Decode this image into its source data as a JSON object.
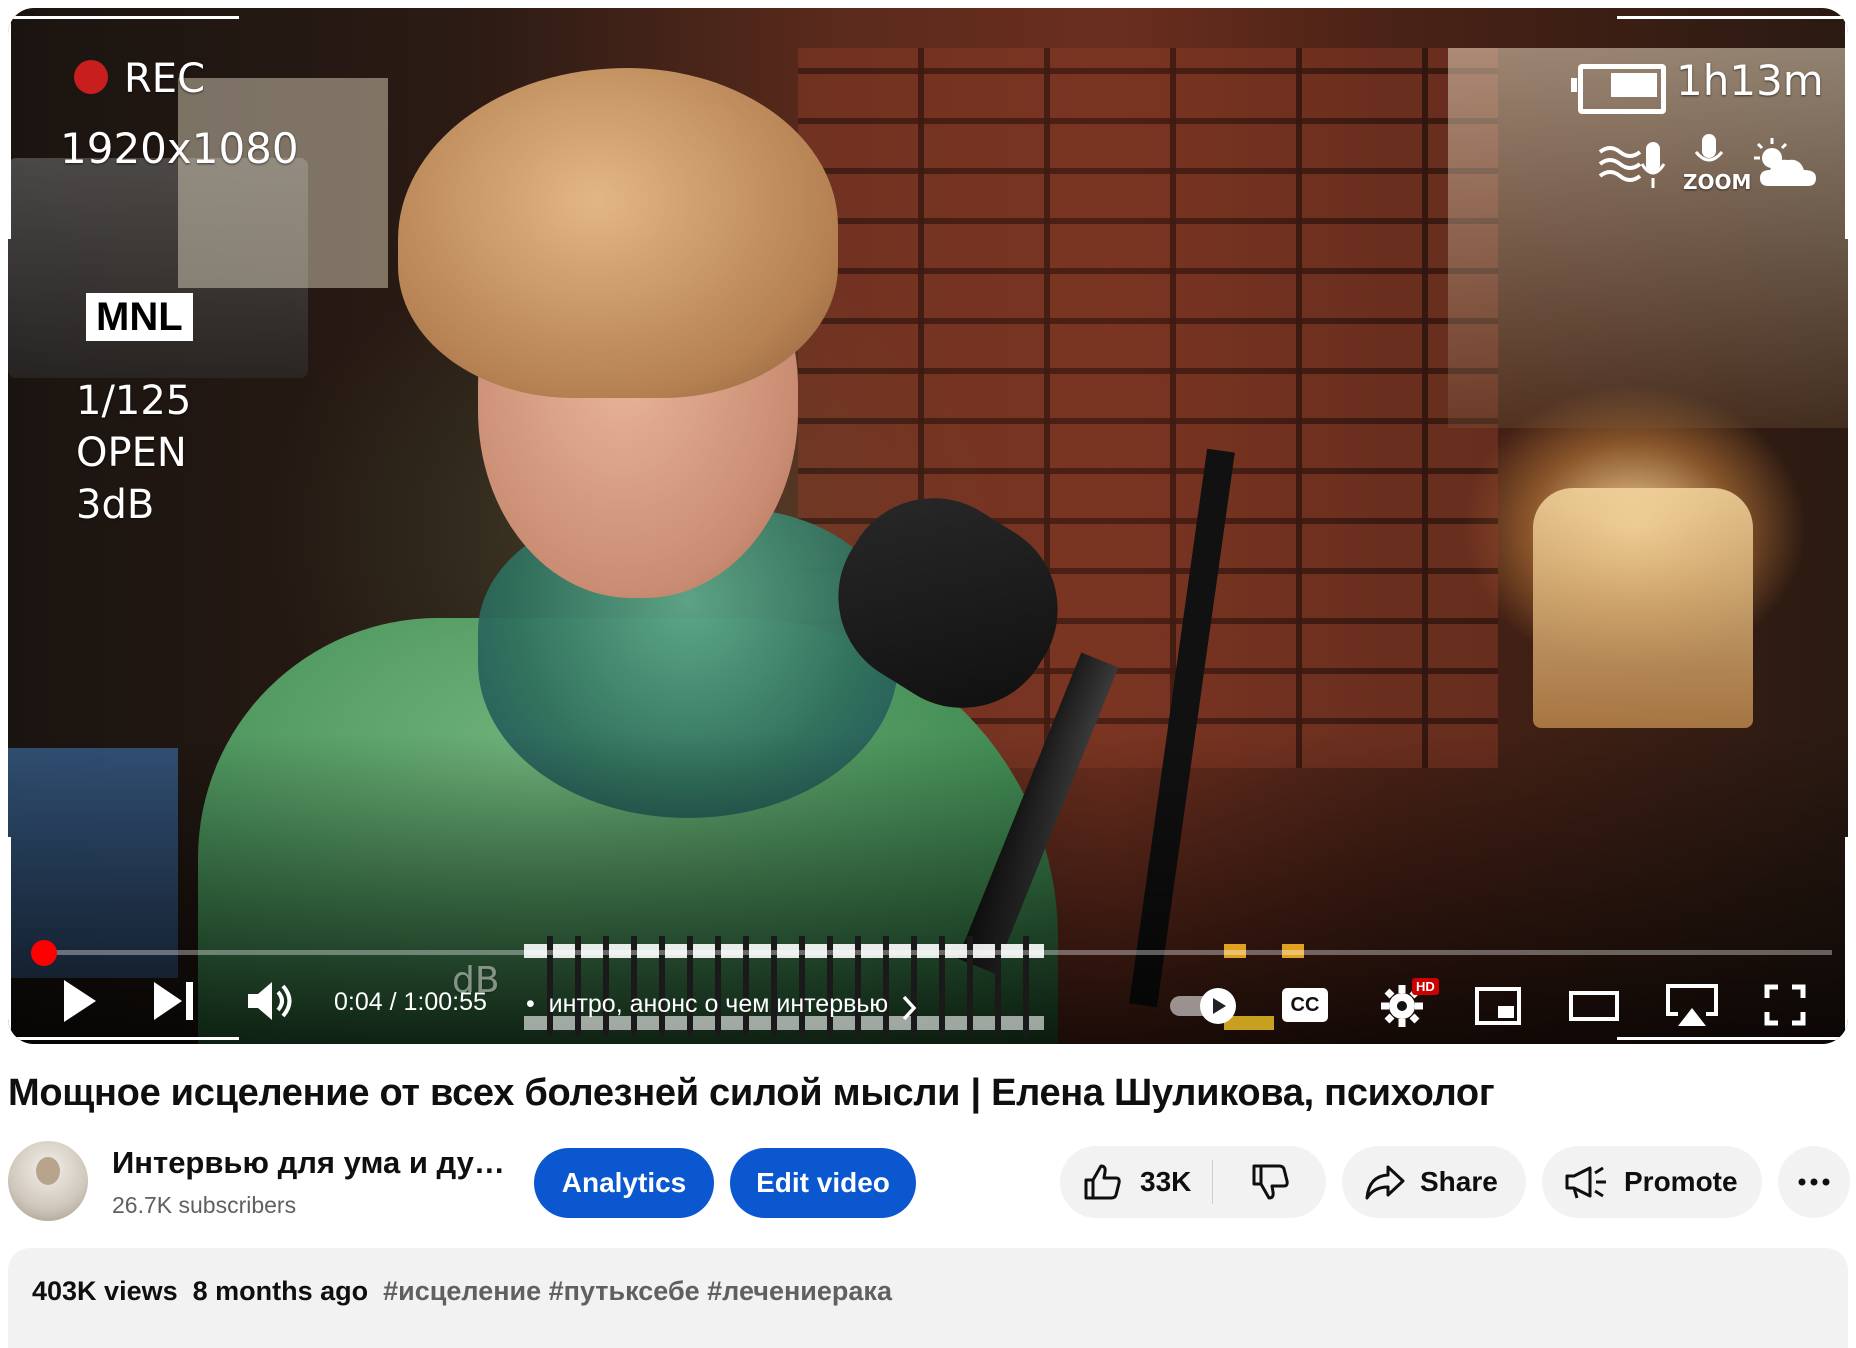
{
  "osd": {
    "rec": "REC",
    "resolution": "1920x1080",
    "mode": "MNL",
    "shutter": "1/125",
    "aperture": "OPEN",
    "gain": "3dB",
    "remaining": "1h13m",
    "zoom": "ZOOM",
    "meter_unit": "dB"
  },
  "player": {
    "time": "0:04 / 1:00:55",
    "chapter_separator": "•",
    "chapter": "интро, анонс о чем интервью",
    "quality_badge": "HD",
    "cc_label": "CC",
    "progress": 0.001
  },
  "video": {
    "title": "Мощное исцеление от всех болезней силой мысли | Елена Шуликова, психолог"
  },
  "channel": {
    "name": "Интервью для ума и ду…",
    "subscribers": "26.7K subscribers"
  },
  "actions": {
    "analytics": "Analytics",
    "edit_video": "Edit video",
    "likes": "33K",
    "share": "Share",
    "promote": "Promote"
  },
  "description": {
    "views": "403K views",
    "age": "8 months ago",
    "tags": "#исцеление #путьксебе #лечениерака"
  },
  "colors": {
    "accent_blue": "#0b57d0",
    "progress_red": "#ff0000",
    "rec_red": "#c81e1e"
  }
}
